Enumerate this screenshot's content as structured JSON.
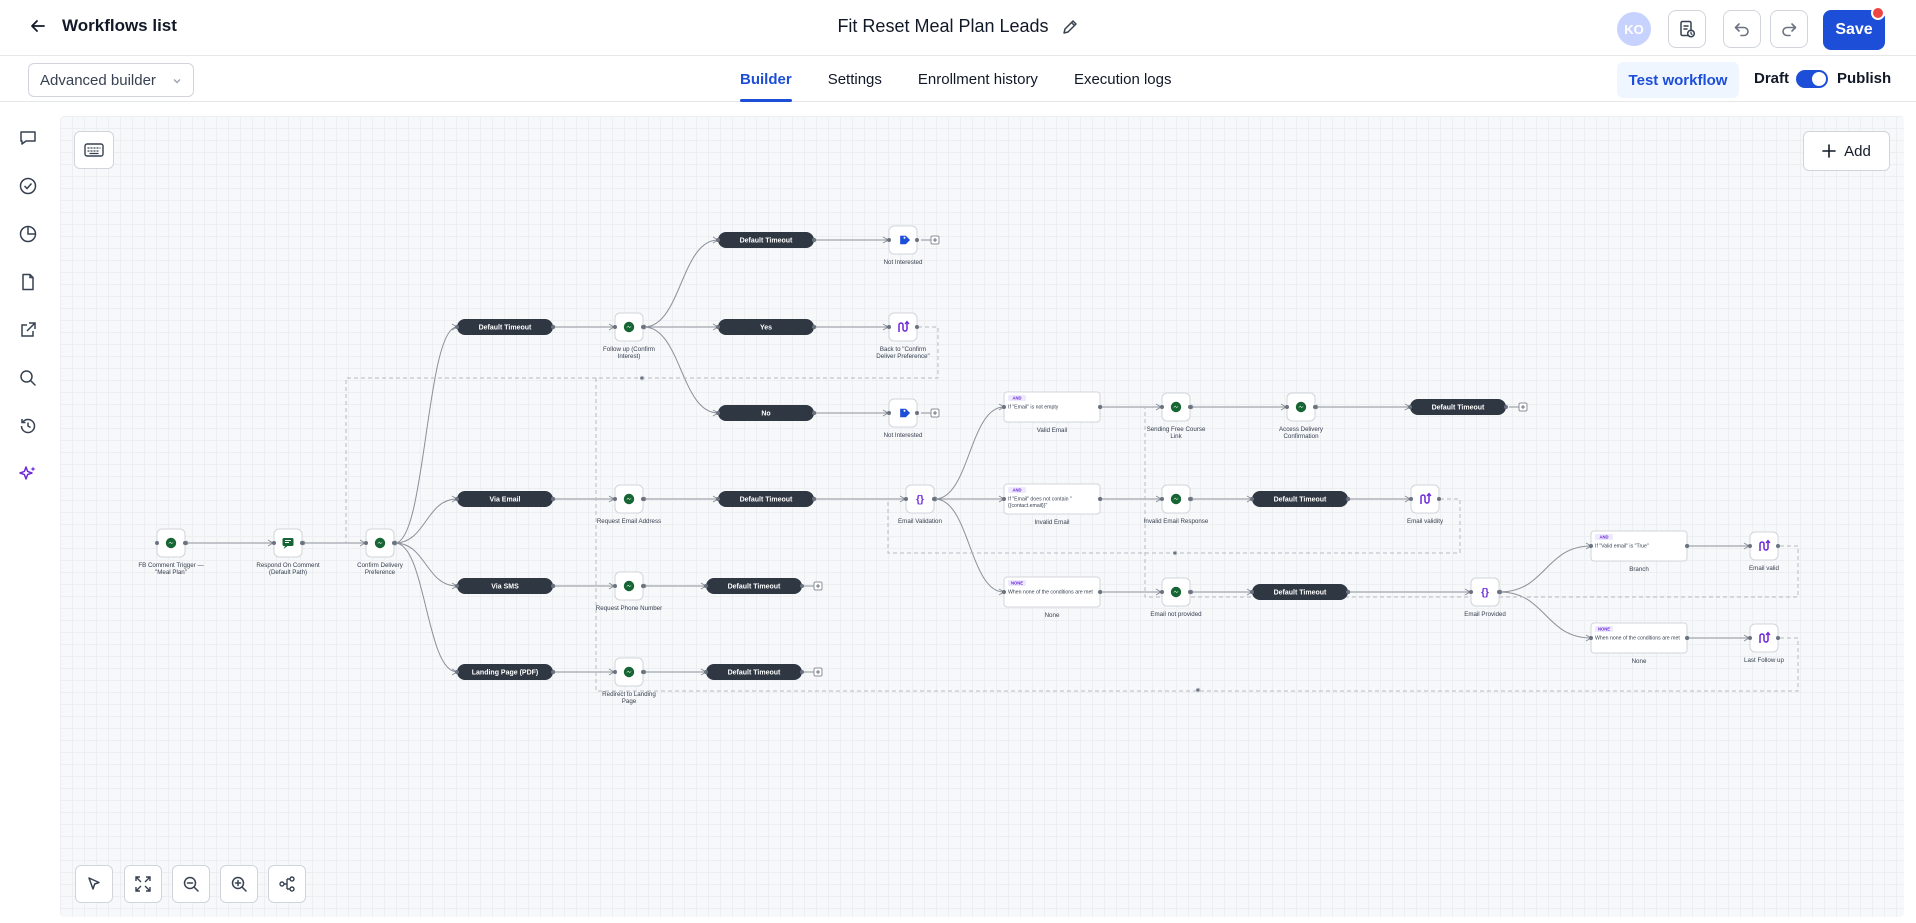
{
  "header": {
    "back_label": "Workflows list",
    "title": "Fit Reset Meal Plan Leads",
    "avatar_initials": "KO",
    "save_label": "Save"
  },
  "subbar": {
    "builder_mode": "Advanced builder",
    "tabs": [
      {
        "label": "Builder",
        "active": true
      },
      {
        "label": "Settings",
        "active": false
      },
      {
        "label": "Enrollment history",
        "active": false
      },
      {
        "label": "Execution logs",
        "active": false
      }
    ],
    "test_label": "Test workflow",
    "draft_label": "Draft",
    "publish_label": "Publish"
  },
  "rail": [
    "chat-icon",
    "check-circle-icon",
    "pie-chart-icon",
    "file-icon",
    "external-link-icon",
    "search-icon",
    "history-icon",
    "sparkle-icon"
  ],
  "canvas": {
    "add_label": "Add"
  },
  "colors": {
    "accent": "#1d4ed8",
    "pill": "#2f3742",
    "messenger": "#166534",
    "condition": "#6d28d9",
    "tag": "#1d4ed8"
  },
  "flow": {
    "pills": [
      {
        "id": "p1",
        "label": "Default Timeout"
      },
      {
        "id": "p2",
        "label": "Via Email"
      },
      {
        "id": "p3",
        "label": "Via SMS"
      },
      {
        "id": "p4",
        "label": "Landing Page (PDF)"
      },
      {
        "id": "p5",
        "label": "Default Timeout"
      },
      {
        "id": "p6",
        "label": "Yes"
      },
      {
        "id": "p7",
        "label": "No"
      },
      {
        "id": "p8",
        "label": "Default Timeout"
      },
      {
        "id": "p9",
        "label": "Default Timeout"
      },
      {
        "id": "p10",
        "label": "Default Timeout"
      },
      {
        "id": "p11",
        "label": "Default Timeout"
      },
      {
        "id": "p12",
        "label": "Default Timeout"
      },
      {
        "id": "p13",
        "label": "Default Timeout"
      }
    ],
    "nodes": [
      {
        "id": "n1",
        "icon": "messenger-icon",
        "label": "FB Comment Trigger —",
        "label2": "\"Meal Plan\""
      },
      {
        "id": "n2",
        "icon": "comment-reply-icon",
        "label": "Respond On Comment",
        "label2": "(Default Path)"
      },
      {
        "id": "n3",
        "icon": "messenger-icon",
        "label": "Confirm Delivery",
        "label2": "Preference"
      },
      {
        "id": "n4",
        "icon": "messenger-icon",
        "label": "Follow up (Confirm",
        "label2": "Interest)"
      },
      {
        "id": "n5",
        "icon": "messenger-icon",
        "label": "Request Email Address",
        "label2": ""
      },
      {
        "id": "n6",
        "icon": "messenger-icon",
        "label": "Request Phone Number",
        "label2": ""
      },
      {
        "id": "n7",
        "icon": "messenger-icon",
        "label": "Redirect to Landing",
        "label2": "Page"
      },
      {
        "id": "n8",
        "icon": "tag-icon",
        "label": "Not Interested",
        "label2": ""
      },
      {
        "id": "n9",
        "icon": "goto-icon",
        "label": "Back to \"Confirm",
        "label2": "Deliver Preference\""
      },
      {
        "id": "n10",
        "icon": "tag-icon",
        "label": "Not Interested",
        "label2": ""
      },
      {
        "id": "n11",
        "icon": "braces-icon",
        "label": "Email Validation",
        "label2": ""
      },
      {
        "id": "n12",
        "icon": "messenger-icon",
        "label": "Sending Free Course",
        "label2": "Link"
      },
      {
        "id": "n13",
        "icon": "messenger-icon",
        "label": "Access Delivery",
        "label2": "Confirmation"
      },
      {
        "id": "n14",
        "icon": "messenger-icon",
        "label": "Invalid Email Response",
        "label2": ""
      },
      {
        "id": "n15",
        "icon": "goto-icon",
        "label": "Email validity",
        "label2": ""
      },
      {
        "id": "n16",
        "icon": "messenger-icon",
        "label": "Email not provided",
        "label2": ""
      },
      {
        "id": "n17",
        "icon": "braces-icon",
        "label": "Email Provided",
        "label2": ""
      },
      {
        "id": "n18",
        "icon": "goto-icon",
        "label": "Email valid",
        "label2": ""
      },
      {
        "id": "n19",
        "icon": "goto-icon",
        "label": "Last Follow up",
        "label2": ""
      }
    ],
    "branches": [
      {
        "id": "b1",
        "tag": "AND",
        "text": "If \"Email\" is not empty",
        "label": "Valid Email"
      },
      {
        "id": "b2",
        "tag": "AND",
        "text": "If \"Email\" does not contain \"",
        "text2": "{{contact.email}}\"",
        "label": "Invalid Email"
      },
      {
        "id": "b3",
        "tag": "NONE",
        "text": "When none of the conditions are met",
        "label": "None"
      },
      {
        "id": "b4",
        "tag": "AND",
        "text": "If \"Valid email\" is \"True\"",
        "label": "Branch"
      },
      {
        "id": "b5",
        "tag": "NONE",
        "text": "When none of the conditions are met",
        "label": "None"
      }
    ]
  }
}
